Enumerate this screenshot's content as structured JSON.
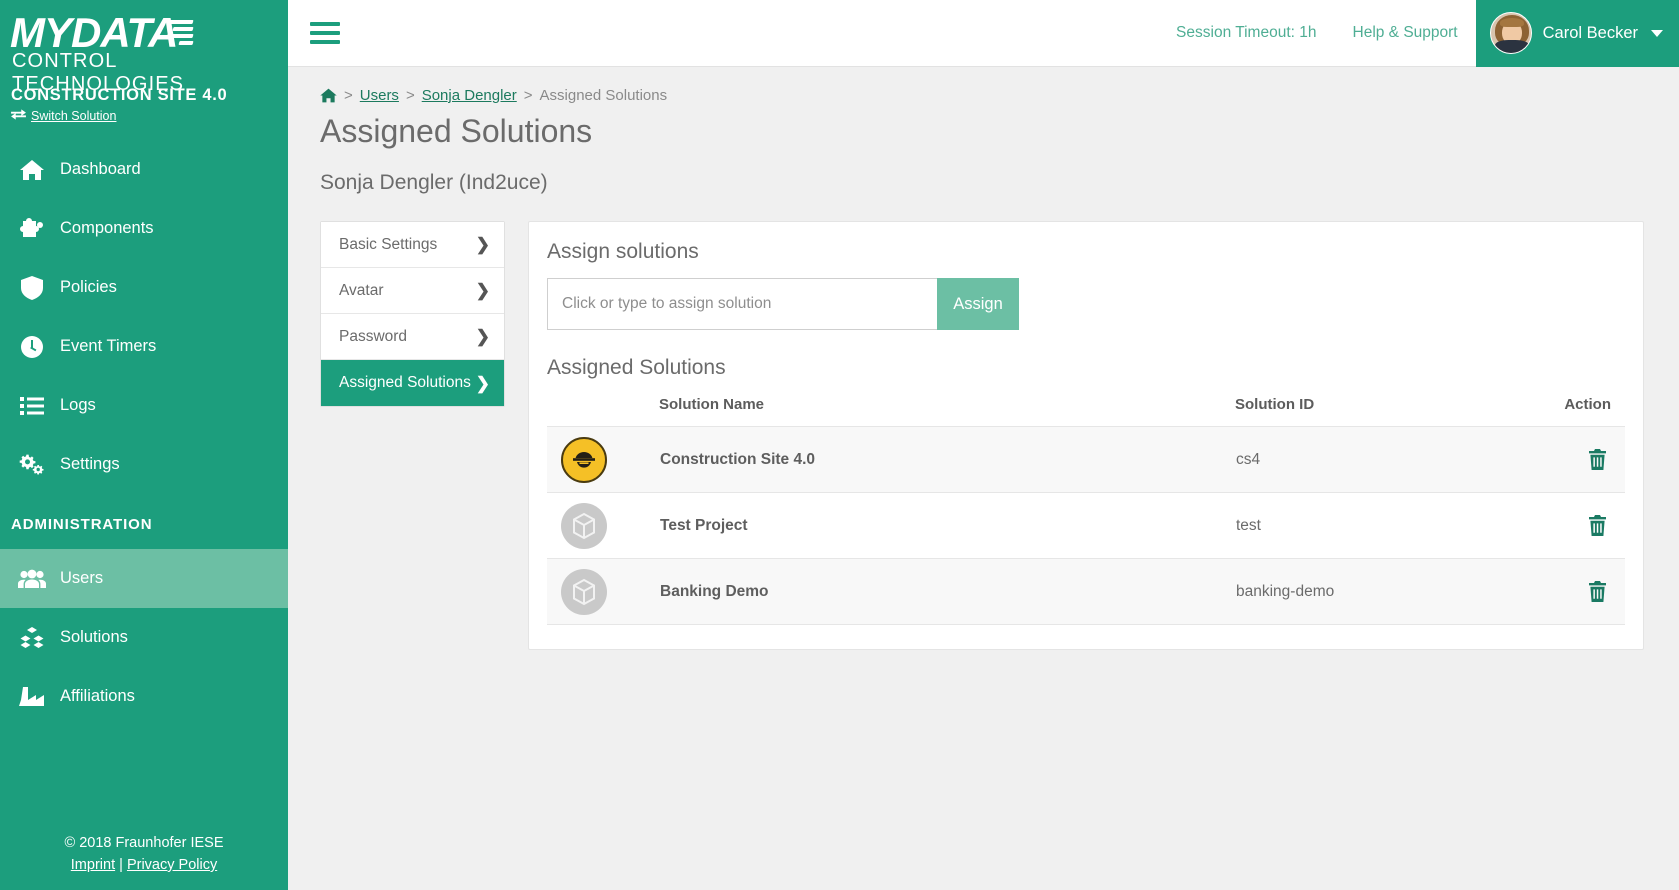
{
  "sidebar": {
    "logo": {
      "main": "MYDATA",
      "sub": "CONTROL TECHNOLOGIES"
    },
    "solution_name": "CONSTRUCTION SITE 4.0",
    "switch_solution": "Switch Solution",
    "nav": [
      {
        "label": "Dashboard",
        "icon": "home-icon",
        "active": false
      },
      {
        "label": "Components",
        "icon": "puzzle-icon",
        "active": false
      },
      {
        "label": "Policies",
        "icon": "shield-icon",
        "active": false
      },
      {
        "label": "Event Timers",
        "icon": "clock-icon",
        "active": false
      },
      {
        "label": "Logs",
        "icon": "list-icon",
        "active": false
      },
      {
        "label": "Settings",
        "icon": "gears-icon",
        "active": false
      }
    ],
    "section_label": "ADMINISTRATION",
    "admin_nav": [
      {
        "label": "Users",
        "icon": "users-icon",
        "active": true
      },
      {
        "label": "Solutions",
        "icon": "cubes-icon",
        "active": false
      },
      {
        "label": "Affiliations",
        "icon": "factory-icon",
        "active": false
      }
    ],
    "footer": {
      "copyright": "© 2018 Fraunhofer IESE",
      "imprint": "Imprint",
      "separator": "|",
      "privacy": "Privacy Policy"
    }
  },
  "topbar": {
    "session_timeout": "Session Timeout: 1h",
    "help_support": "Help & Support",
    "user_name": "Carol Becker"
  },
  "breadcrumb": {
    "home": "home-icon",
    "sep": ">",
    "users": "Users",
    "user": "Sonja Dengler",
    "current": "Assigned Solutions"
  },
  "page": {
    "title": "Assigned Solutions",
    "subtitle": "Sonja Dengler (Ind2uce)"
  },
  "tabs": [
    {
      "label": "Basic Settings",
      "active": false
    },
    {
      "label": "Avatar",
      "active": false
    },
    {
      "label": "Password",
      "active": false
    },
    {
      "label": "Assigned Solutions",
      "active": true
    }
  ],
  "assign": {
    "heading": "Assign solutions",
    "placeholder": "Click or type to assign solution",
    "value": "",
    "button": "Assign"
  },
  "table": {
    "heading": "Assigned Solutions",
    "columns": {
      "icon": "",
      "name": "Solution Name",
      "id": "Solution ID",
      "action": "Action"
    },
    "rows": [
      {
        "icon": "construction-worker-icon",
        "name": "Construction Site 4.0",
        "id": "cs4",
        "action": "delete-icon"
      },
      {
        "icon": "cube-placeholder-icon",
        "name": "Test Project",
        "id": "test",
        "action": "delete-icon"
      },
      {
        "icon": "cube-placeholder-icon",
        "name": "Banking Demo",
        "id": "banking-demo",
        "action": "delete-icon"
      }
    ]
  },
  "colors": {
    "brand_green": "#1c9e7d",
    "active_nav": "#6cbfa4",
    "assign_button": "#6cbfa4",
    "link_green": "#1c7a5e",
    "trash_green": "#1a7a63",
    "worker_yellow": "#f5c026"
  }
}
